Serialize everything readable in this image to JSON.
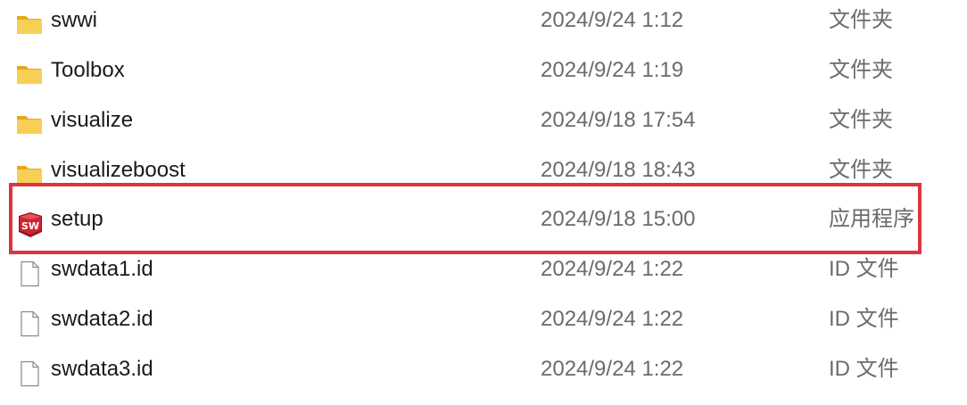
{
  "files": [
    {
      "name": "swwi",
      "modified": "2024/9/24 1:12",
      "type": "文件夹",
      "icon": "folder-icon"
    },
    {
      "name": "Toolbox",
      "modified": "2024/9/24 1:19",
      "type": "文件夹",
      "icon": "folder-icon"
    },
    {
      "name": "visualize",
      "modified": "2024/9/18 17:54",
      "type": "文件夹",
      "icon": "folder-icon"
    },
    {
      "name": "visualizeboost",
      "modified": "2024/9/18 18:43",
      "type": "文件夹",
      "icon": "folder-icon"
    },
    {
      "name": "setup",
      "modified": "2024/9/18 15:00",
      "type": "应用程序",
      "icon": "solidworks-app-icon",
      "highlighted": true
    },
    {
      "name": "swdata1.id",
      "modified": "2024/9/24 1:22",
      "type": "ID 文件",
      "icon": "document-icon"
    },
    {
      "name": "swdata2.id",
      "modified": "2024/9/24 1:22",
      "type": "ID 文件",
      "icon": "document-icon"
    },
    {
      "name": "swdata3.id",
      "modified": "2024/9/24 1:22",
      "type": "ID 文件",
      "icon": "document-icon"
    }
  ],
  "colors": {
    "highlight": "#d9363e",
    "folder": "#f5c94c",
    "app_badge": "#c8202f"
  }
}
